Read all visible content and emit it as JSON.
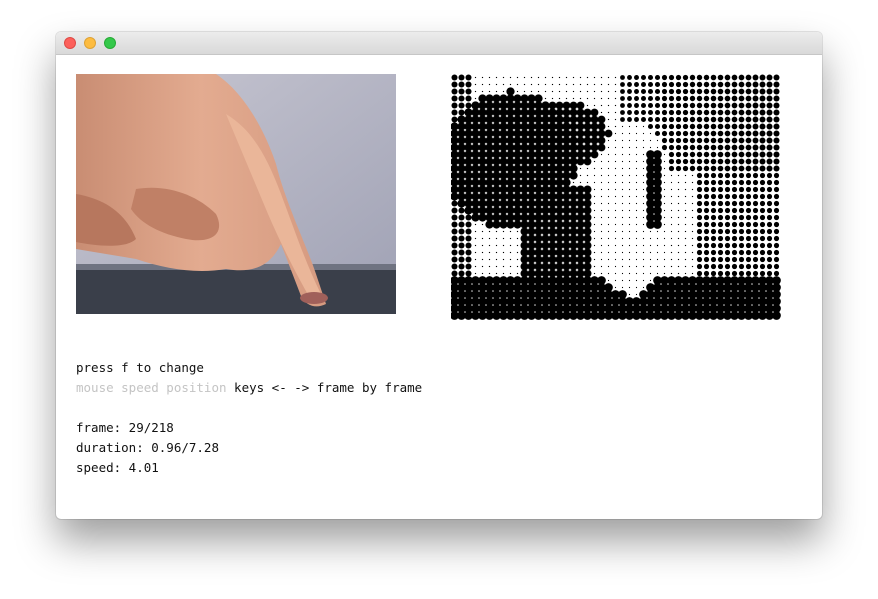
{
  "window": {
    "controls": [
      "close",
      "minimize",
      "zoom"
    ]
  },
  "instructions": {
    "line1": "press f to change",
    "mode_muted": "mouse speed position",
    "mode_active": "keys <- -> frame by frame"
  },
  "stats": {
    "frame": "frame: 29/218",
    "duration": "duration: 0.96/7.28",
    "speed": "speed: 4.01"
  },
  "colors": {
    "muted_text": "#c4c4c4",
    "text": "#111111",
    "dots": "#000000"
  }
}
